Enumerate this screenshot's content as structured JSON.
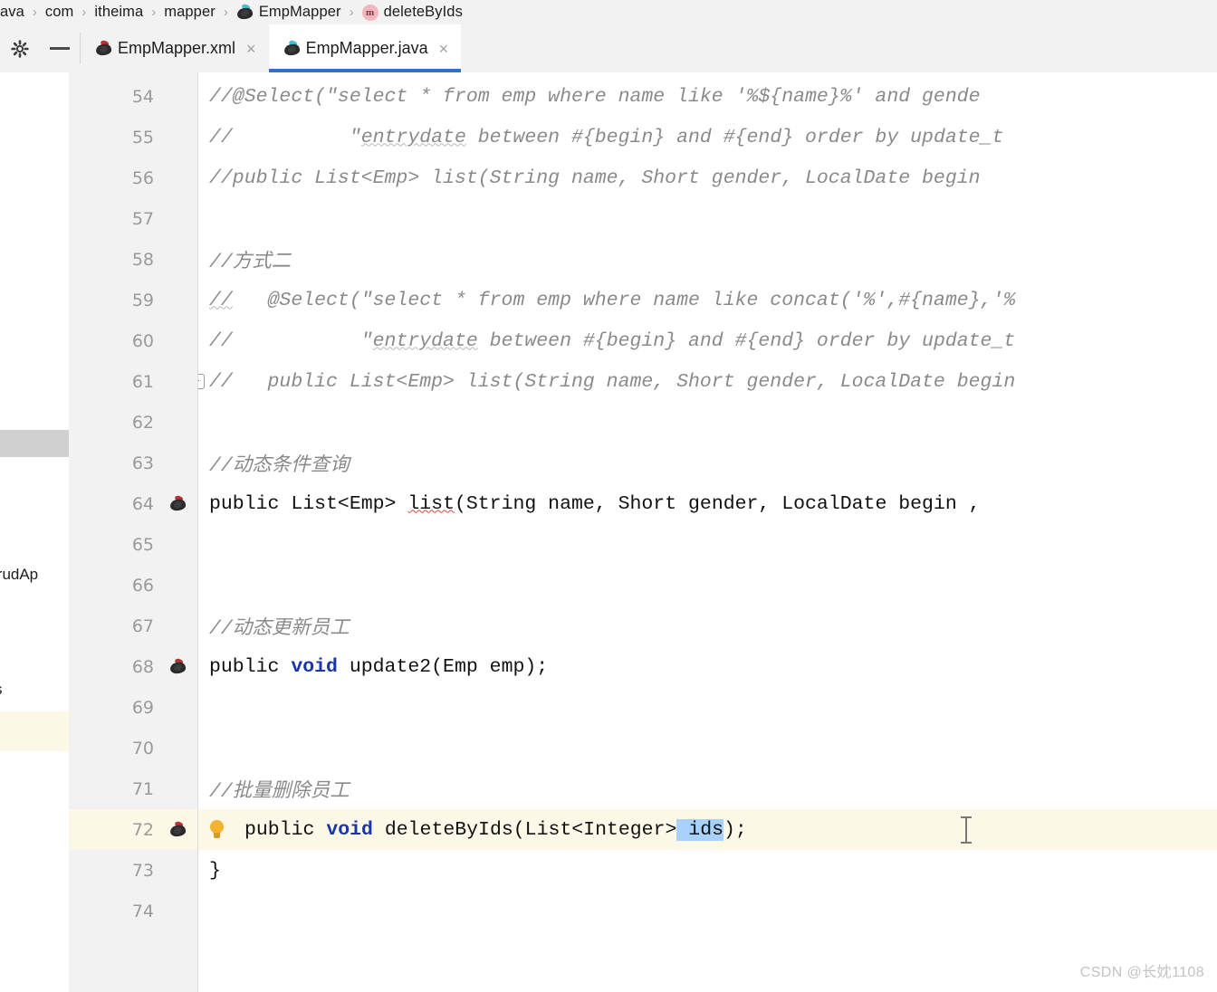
{
  "breadcrumb": {
    "items": [
      {
        "label": "ava",
        "icon": "none"
      },
      {
        "label": "com",
        "icon": "none"
      },
      {
        "label": "itheima",
        "icon": "none"
      },
      {
        "label": "mapper",
        "icon": "none"
      },
      {
        "label": "EmpMapper",
        "icon": "java-class-icon"
      },
      {
        "label": "deleteByIds",
        "icon": "method-icon"
      }
    ],
    "separator": "›"
  },
  "toolbar": {
    "settings_icon": "gear-icon",
    "collapse_icon": "minus-icon"
  },
  "tabs": [
    {
      "label": "EmpMapper.xml",
      "icon": "xml-file-icon",
      "close": "×",
      "active": false
    },
    {
      "label": "EmpMapper.java",
      "icon": "java-file-icon",
      "close": "×",
      "active": true
    }
  ],
  "project_strip": {
    "partial_label_1": "sCrudAp",
    "partial_label_2": "s"
  },
  "editor": {
    "selection_color": "#a8d1fb",
    "highlight_line_color": "#fbf8e8",
    "keyword_color": "#1a36a8",
    "comment_color": "#8a8a8a",
    "caret_line": 72,
    "lines": [
      {
        "num": "54",
        "marker": "",
        "text": "//@Select(\"select * from emp where name like '%${name}%' and gende"
      },
      {
        "num": "55",
        "marker": "",
        "text": "//          \"entrydate between #{begin} and #{end} order by update_t"
      },
      {
        "num": "56",
        "marker": "",
        "text": "//public List<Emp> list(String name, Short gender, LocalDate begin"
      },
      {
        "num": "57",
        "marker": "",
        "text": ""
      },
      {
        "num": "58",
        "marker": "",
        "text": "//方式二"
      },
      {
        "num": "59",
        "marker": "",
        "text": "//   @Select(\"select * from emp where name like concat('%',#{name},'%"
      },
      {
        "num": "60",
        "marker": "",
        "text": "//           \"entrydate between #{begin} and #{end} order by update_t"
      },
      {
        "num": "61",
        "marker": "",
        "text": "//   public List<Emp> list(String name, Short gender, LocalDate begin"
      },
      {
        "num": "62",
        "marker": "",
        "text": ""
      },
      {
        "num": "63",
        "marker": "",
        "text": "//动态条件查询"
      },
      {
        "num": "64",
        "marker": "java-bean-icon",
        "text": "public List<Emp> list(String name, Short gender, LocalDate begin ,"
      },
      {
        "num": "65",
        "marker": "",
        "text": ""
      },
      {
        "num": "66",
        "marker": "",
        "text": ""
      },
      {
        "num": "67",
        "marker": "",
        "text": "//动态更新员工"
      },
      {
        "num": "68",
        "marker": "java-bean-icon",
        "text": "public void update2(Emp emp);"
      },
      {
        "num": "69",
        "marker": "",
        "text": ""
      },
      {
        "num": "70",
        "marker": "",
        "text": ""
      },
      {
        "num": "71",
        "marker": "",
        "text": "//批量删除员工"
      },
      {
        "num": "72",
        "marker": "java-bean-icon",
        "text": "public void deleteByIds(List<Integer> ids);"
      },
      {
        "num": "73",
        "marker": "",
        "text": "}"
      },
      {
        "num": "74",
        "marker": "",
        "text": ""
      }
    ],
    "line_72_parts": {
      "kw1": "public",
      "kw2": "void",
      "method": "deleteByIds(List<Integer>",
      "selected": " ids",
      "tail": ");"
    },
    "line_64_parts": {
      "kw1": "public",
      "type": " List<Emp> ",
      "method": "list",
      "tail": "(String name, Short gender, LocalDate begin ,"
    },
    "line_68_parts": {
      "kw1": "public",
      "kw2": "void",
      "tail": " update2(Emp emp);"
    }
  },
  "watermark": "CSDN @长妉1108"
}
